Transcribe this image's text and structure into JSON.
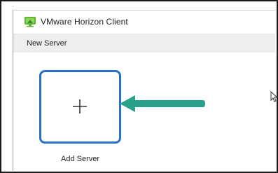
{
  "window": {
    "title": "VMware Horizon Client"
  },
  "menu": {
    "items": [
      {
        "label": "New Server"
      }
    ]
  },
  "main": {
    "add_server": {
      "label": "Add Server",
      "icon": "plus-icon"
    }
  },
  "annotation": {
    "arrow_icon": "pointer-arrow-icon",
    "arrow_color": "#2aa18a"
  },
  "colors": {
    "tile_border": "#2a72c6",
    "menubar_bg": "#eeeeee",
    "logo_green": "#5cb82e"
  }
}
